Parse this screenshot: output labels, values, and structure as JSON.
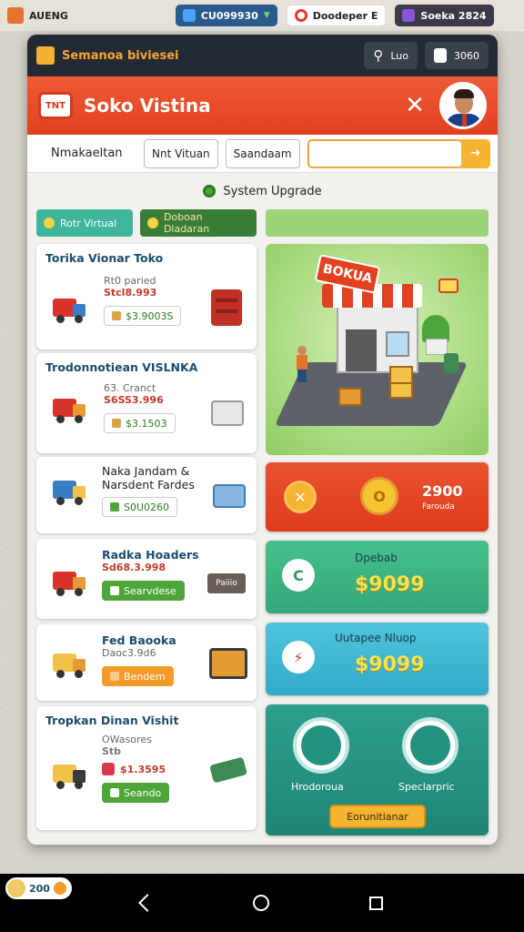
{
  "status_strip": {
    "app_name": "AUENG",
    "blue_chip": "CU099930",
    "red_chip": "Doodeper E",
    "purple_chip": "Soeka 2824"
  },
  "panel": {
    "system_title": "Semanoa biviesei",
    "search_label": "Luo",
    "counter_label": "3060"
  },
  "header": {
    "title": "Soko Vistina",
    "logo_text": "TNT"
  },
  "search_row": {
    "label": "Nmakaeltan",
    "chip1": "Nnt Vituan",
    "chip2": "Saandaam",
    "input_placeholder": ""
  },
  "upgrade": {
    "label": "System Upgrade"
  },
  "tabs": [
    {
      "label": "Rotr Virtual"
    },
    {
      "label": "Doboan Dladaran"
    }
  ],
  "cards": [
    {
      "title": "Torika Vionar Toko",
      "sub": "Rt0 paried",
      "price": "Stcl8.993",
      "tag": "$3.9003S"
    },
    {
      "title": "Trodonnotiean VISLNKA",
      "sub": "63. Cranct",
      "price": "S6SS3.996",
      "tag": "$3.1503"
    },
    {
      "title": "Naka Jandam &",
      "title2": "Narsdent Fardes",
      "tag": "S0U0260"
    },
    {
      "title": "Radka Hoaders",
      "price": "Sd68.3.998",
      "tag": "Searvdese",
      "side_btn": "Paiiio"
    },
    {
      "title": "Fed Baooka",
      "sub": "Daoc3.9d6",
      "tag": "Bendem"
    },
    {
      "title": "Tropkan Dinan Vishit",
      "sub": "OWasores",
      "price2": "Stb",
      "tag_price": "$1.3595",
      "tag": "Seando"
    }
  ],
  "scene": {
    "sign": "BOKUA"
  },
  "tiles": {
    "red": {
      "amount": "2900",
      "sub": "Farouda"
    },
    "green": {
      "label": "Dpebab",
      "price": "$9099"
    },
    "blue": {
      "label": "Uutapee Nluop",
      "price": "$9099"
    },
    "teal": {
      "left_label": "Hrodoroua",
      "right_label": "Speclarpric",
      "button": "Eorunitianar"
    }
  },
  "bottom_badge": {
    "value": "200"
  }
}
